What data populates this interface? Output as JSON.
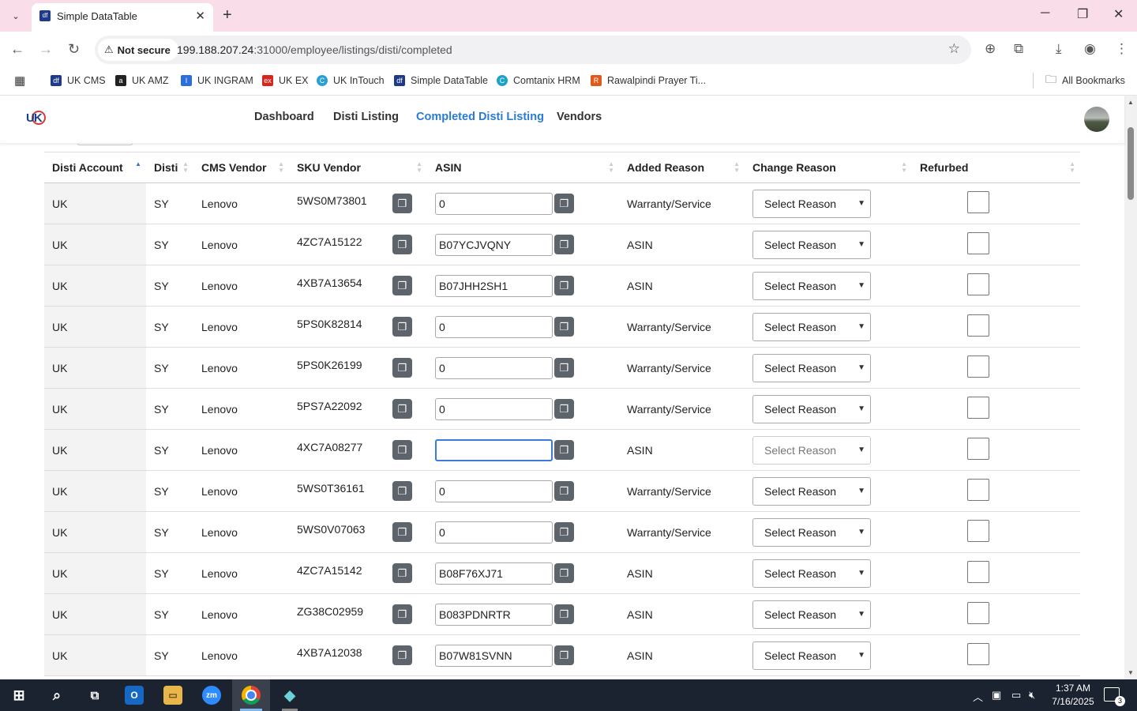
{
  "browser": {
    "tab_title": "Simple DataTable",
    "tab_favicon": "df",
    "security_label": "Not secure",
    "url_host": "199.188.207.24",
    "url_path": ":31000/employee/listings/disti/completed",
    "bookmarks": [
      {
        "label": "UK CMS",
        "icon": "df",
        "color": "#1e3a8a"
      },
      {
        "label": "UK AMZ",
        "icon": "a",
        "color": "#222222"
      },
      {
        "label": "UK INGRAM",
        "icon": "I",
        "color": "#2a6fdb"
      },
      {
        "label": "UK EX",
        "icon": "ex",
        "color": "#d9261c"
      },
      {
        "label": "UK InTouch",
        "icon": "C",
        "color": "#2a9fd6"
      },
      {
        "label": "Simple DataTable",
        "icon": "df",
        "color": "#1e3a8a"
      },
      {
        "label": "Comtanix HRM",
        "icon": "C",
        "color": "#1ba3c9"
      },
      {
        "label": "Rawalpindi Prayer Ti...",
        "icon": "R",
        "color": "#e05a1c"
      }
    ],
    "all_bookmarks": "All Bookmarks"
  },
  "app": {
    "logo_text": "UK",
    "nav": [
      "Dashboard",
      "Disti Listing",
      "Completed Disti Listing",
      "Vendors"
    ],
    "active_nav": "Completed Disti Listing"
  },
  "table": {
    "columns": [
      "Disti Account",
      "Disti",
      "CMS Vendor",
      "SKU Vendor",
      "ASIN",
      "Added Reason",
      "Change Reason",
      "Refurbed"
    ],
    "select_placeholder": "Select Reason",
    "rows": [
      {
        "account": "UK",
        "disti": "SY",
        "vendor": "Lenovo",
        "sku": "5WS0M73801",
        "asin": "0",
        "reason": "Warranty/Service"
      },
      {
        "account": "UK",
        "disti": "SY",
        "vendor": "Lenovo",
        "sku": "4ZC7A15122",
        "asin": "B07YCJVQNY",
        "reason": "ASIN"
      },
      {
        "account": "UK",
        "disti": "SY",
        "vendor": "Lenovo",
        "sku": "4XB7A13654",
        "asin": "B07JHH2SH1",
        "reason": "ASIN"
      },
      {
        "account": "UK",
        "disti": "SY",
        "vendor": "Lenovo",
        "sku": "5PS0K82814",
        "asin": "0",
        "reason": "Warranty/Service"
      },
      {
        "account": "UK",
        "disti": "SY",
        "vendor": "Lenovo",
        "sku": "5PS0K26199",
        "asin": "0",
        "reason": "Warranty/Service"
      },
      {
        "account": "UK",
        "disti": "SY",
        "vendor": "Lenovo",
        "sku": "5PS7A22092",
        "asin": "0",
        "reason": "Warranty/Service"
      },
      {
        "account": "UK",
        "disti": "SY",
        "vendor": "Lenovo",
        "sku": "4XC7A08277",
        "asin": "",
        "reason": "ASIN",
        "focused": true
      },
      {
        "account": "UK",
        "disti": "SY",
        "vendor": "Lenovo",
        "sku": "5WS0T36161",
        "asin": "0",
        "reason": "Warranty/Service"
      },
      {
        "account": "UK",
        "disti": "SY",
        "vendor": "Lenovo",
        "sku": "5WS0V07063",
        "asin": "0",
        "reason": "Warranty/Service"
      },
      {
        "account": "UK",
        "disti": "SY",
        "vendor": "Lenovo",
        "sku": "4ZC7A15142",
        "asin": "B08F76XJ71",
        "reason": "ASIN"
      },
      {
        "account": "UK",
        "disti": "SY",
        "vendor": "Lenovo",
        "sku": "ZG38C02959",
        "asin": "B083PDNRTR",
        "reason": "ASIN"
      },
      {
        "account": "UK",
        "disti": "SY",
        "vendor": "Lenovo",
        "sku": "4XB7A12038",
        "asin": "B07W81SVNN",
        "reason": "ASIN"
      }
    ]
  },
  "taskbar": {
    "time": "1:37 AM",
    "date": "7/16/2025",
    "notifications": "3"
  }
}
